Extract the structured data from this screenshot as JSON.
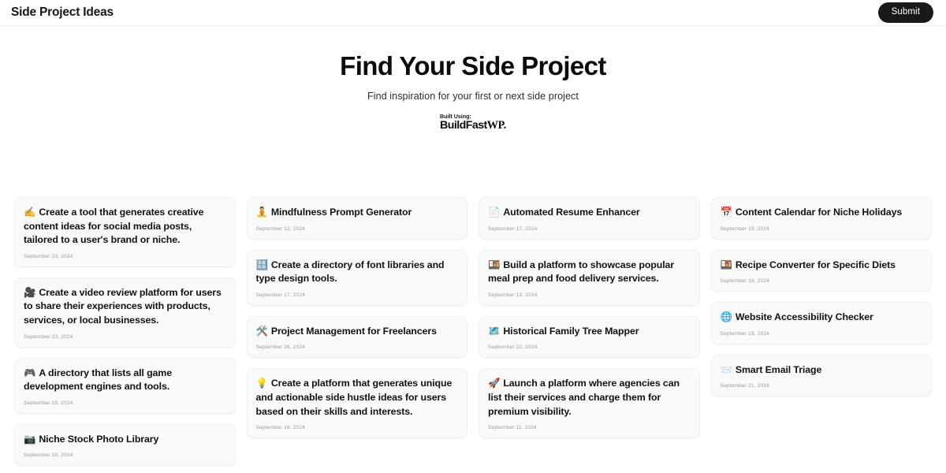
{
  "header": {
    "title": "Side Project Ideas",
    "submit_label": "Submit"
  },
  "hero": {
    "title": "Find Your Side Project",
    "subtitle": "Find inspiration for your first or next side project",
    "built_using_label": "Built Using:",
    "built_logo_main": "BuildFast",
    "built_logo_suffix": "WP."
  },
  "colors": {
    "page_background": "#ffffff",
    "card_background": "#fafafa",
    "card_border": "#f0f0f1",
    "button_background": "#19191c",
    "button_text": "#ffffff",
    "title_text": "#0c0c0f",
    "date_text": "#9a9aa1"
  },
  "grid": {
    "columns": [
      {
        "cards": [
          {
            "emoji": "✍️",
            "emoji_name": "writing-hand-emoji",
            "title": "Create a tool that generates creative content ideas for social media posts, tailored to a user's brand or niche.",
            "date": "September 23, 2024"
          },
          {
            "emoji": "🎥",
            "emoji_name": "movie-camera-emoji",
            "title": "Create a video review platform for users to share their experiences with products, services, or local businesses.",
            "date": "September 23, 2024"
          },
          {
            "emoji": "🎮",
            "emoji_name": "video-game-emoji",
            "title": "A directory that lists all game development engines and tools.",
            "date": "September 18, 2024"
          },
          {
            "emoji": "📷",
            "emoji_name": "camera-emoji",
            "title": "Niche Stock Photo Library",
            "date": "September 18, 2024"
          }
        ]
      },
      {
        "cards": [
          {
            "emoji": "🧘",
            "emoji_name": "meditation-emoji",
            "title": "Mindfulness Prompt Generator",
            "date": "September 12, 2024"
          },
          {
            "emoji": "🔠",
            "emoji_name": "input-latin-uppercase-emoji",
            "title": "Create a directory of font libraries and type design tools.",
            "date": "September 17, 2024"
          },
          {
            "emoji": "🛠️",
            "emoji_name": "hammer-and-wrench-emoji",
            "title": "Project Management for Freelancers",
            "date": "September 26, 2024"
          },
          {
            "emoji": "💡",
            "emoji_name": "light-bulb-emoji",
            "title": "Create a platform that generates unique and actionable side hustle ideas for users based on their skills and interests.",
            "date": "September 16, 2024"
          }
        ]
      },
      {
        "cards": [
          {
            "emoji": "📄",
            "emoji_name": "page-facing-up-emoji",
            "title": "Automated Resume Enhancer",
            "date": "September 17, 2024"
          },
          {
            "emoji": "🍱",
            "emoji_name": "bento-box-emoji",
            "title": "Build a platform to showcase popular meal prep and food delivery services.",
            "date": "September 13, 2024"
          },
          {
            "emoji": "🗺️",
            "emoji_name": "world-map-emoji",
            "title": "Historical Family Tree Mapper",
            "date": "September 22, 2024"
          },
          {
            "emoji": "🚀",
            "emoji_name": "rocket-emoji",
            "title": "Launch a platform where agencies can list their services and charge them for premium visibility.",
            "date": "September 11, 2024"
          }
        ]
      },
      {
        "cards": [
          {
            "emoji": "📅",
            "emoji_name": "calendar-emoji",
            "title": "Content Calendar for Niche Holidays",
            "date": "September 19, 2024"
          },
          {
            "emoji": "🍱",
            "emoji_name": "bento-box-emoji",
            "title": "Recipe Converter for Specific Diets",
            "date": "September 18, 2024"
          },
          {
            "emoji": "🌐",
            "emoji_name": "globe-with-meridians-emoji",
            "title": "Website Accessibility Checker",
            "date": "September 19, 2024"
          },
          {
            "emoji": "📨",
            "emoji_name": "incoming-envelope-emoji",
            "title": "Smart Email Triage",
            "date": "September 21, 2024"
          }
        ]
      }
    ]
  }
}
